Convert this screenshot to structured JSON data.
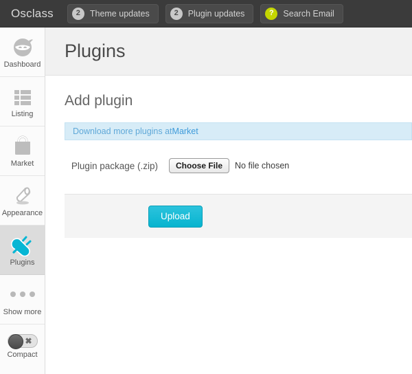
{
  "topbar": {
    "brand": "Osclass",
    "pills": [
      {
        "count": "2",
        "label": "Theme updates",
        "badge_color": "#c8c8c8",
        "badge_style": "gray"
      },
      {
        "count": "2",
        "label": "Plugin updates",
        "badge_color": "#c8c8c8",
        "badge_style": "gray"
      },
      {
        "count": "?",
        "label": "Search Email",
        "badge_color": "#c4d600",
        "badge_style": "lime"
      }
    ]
  },
  "sidebar": {
    "items": [
      {
        "label": "Dashboard",
        "icon": "ninja-head-icon",
        "active": false
      },
      {
        "label": "Listing",
        "icon": "list-icon",
        "active": false
      },
      {
        "label": "Market",
        "icon": "shopping-bag-icon",
        "active": false
      },
      {
        "label": "Appearance",
        "icon": "paint-roller-icon",
        "active": false
      },
      {
        "label": "Plugins",
        "icon": "plug-icon",
        "active": true
      },
      {
        "label": "Show more",
        "icon": "ellipsis-icon",
        "active": false
      }
    ],
    "compact": {
      "label": "Compact",
      "icon": "toggle-switch-icon",
      "state": "off",
      "mark": "✖"
    }
  },
  "main": {
    "page_title": "Plugins",
    "section_title": "Add plugin",
    "alert": {
      "text_before": "Download more plugins at ",
      "link_text": "Market"
    },
    "field": {
      "label": "Plugin package (.zip)",
      "choose_button": "Choose File",
      "file_status": "No file chosen"
    },
    "upload_button": "Upload"
  },
  "colors": {
    "accent": "#07b4cf",
    "topbar_bg": "#3b3b3b",
    "lime_badge": "#c4d600",
    "alert_bg": "#d7ecf7",
    "alert_text": "#5fa8d8",
    "link": "#3d9ada"
  }
}
